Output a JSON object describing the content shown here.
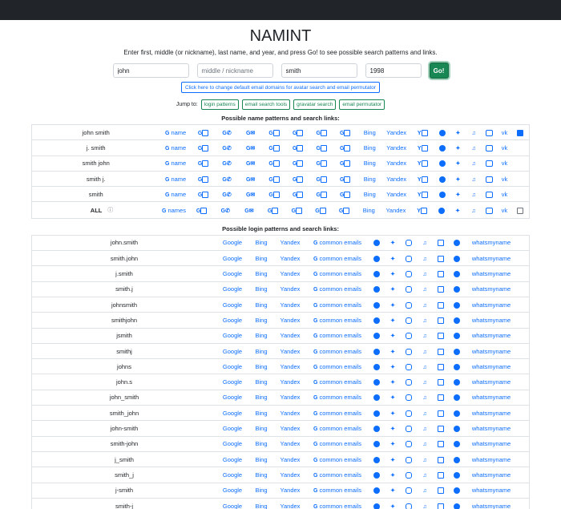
{
  "title": "NAMINT",
  "description": "Enter first, middle (or nickname), last name, and year, and press Go! to see possible search patterns and links.",
  "inputs": {
    "first": "john",
    "middle_placeholder": "middle / nickname",
    "last": "smith",
    "year": "1998",
    "go_label": "Go!"
  },
  "domain_button": "Click here to change default email domains for avatar search and email permutator",
  "jump": {
    "label": "Jump to:",
    "buttons": [
      "login patterns",
      "email search tools",
      "gravatar search",
      "email permutator"
    ]
  },
  "names_section": {
    "heading": "Possible name patterns and search links:",
    "rows": [
      {
        "name": "john smith",
        "g": "name"
      },
      {
        "name": "j. smith",
        "g": "name"
      },
      {
        "name": "smith john",
        "g": "name"
      },
      {
        "name": "smith j.",
        "g": "name"
      },
      {
        "name": "smith",
        "g": "name"
      },
      {
        "name": "ALL",
        "g": "names"
      }
    ],
    "bing": "Bing",
    "yandex": "Yandex",
    "vk": "vk"
  },
  "login_section": {
    "heading": "Possible login patterns and search links:",
    "google": "Google",
    "bing": "Bing",
    "yandex": "Yandex",
    "emails": "common emails",
    "whatsmyname": "whatsmyname",
    "rows": [
      "john.smith",
      "smith.john",
      "j.smith",
      "smith.j",
      "johnsmith",
      "smithjohn",
      "jsmith",
      "smithj",
      "johns",
      "john.s",
      "john_smith",
      "smith_john",
      "john-smith",
      "smith-john",
      "j_smith",
      "smith_j",
      "j-smith",
      "smith-j"
    ]
  },
  "colors": {
    "accent": "#0d6efd",
    "go": "#198754",
    "topbar": "#212529"
  }
}
